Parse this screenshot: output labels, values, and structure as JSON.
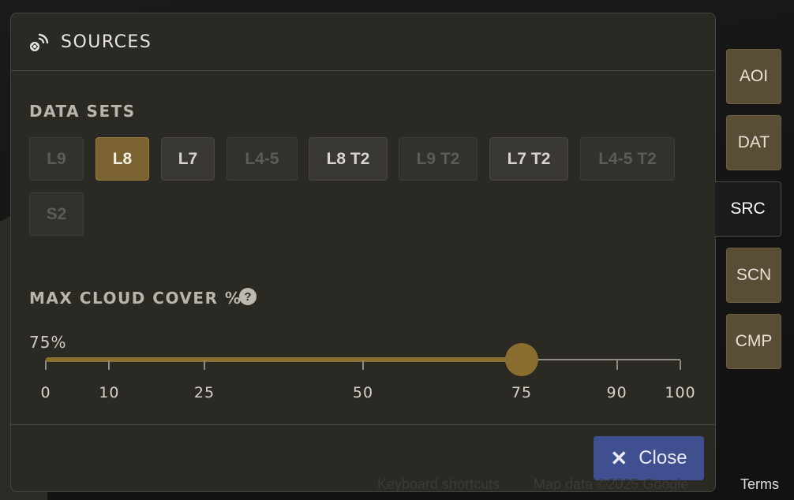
{
  "panel": {
    "title": "SOURCES",
    "icon": "satellite-icon"
  },
  "datasets": {
    "label": "DATA SETS",
    "items": [
      {
        "label": "L9",
        "state": "disabled"
      },
      {
        "label": "L8",
        "state": "selected"
      },
      {
        "label": "L7",
        "state": "enabled"
      },
      {
        "label": "L4-5",
        "state": "disabled"
      },
      {
        "label": "L8 T2",
        "state": "enabled"
      },
      {
        "label": "L9 T2",
        "state": "disabled"
      },
      {
        "label": "L7 T2",
        "state": "enabled"
      },
      {
        "label": "L4-5 T2",
        "state": "disabled"
      },
      {
        "label": "S2",
        "state": "disabled"
      }
    ]
  },
  "cloud_cover": {
    "label": "MAX CLOUD COVER %",
    "help_icon": "?",
    "value_text": "75%",
    "value": 75,
    "ticks": [
      "0",
      "10",
      "25",
      "50",
      "75",
      "90",
      "100"
    ]
  },
  "footer": {
    "close_label": "Close",
    "close_icon": "✕"
  },
  "side_tabs": [
    {
      "label": "AOI",
      "active": false
    },
    {
      "label": "DAT",
      "active": false
    },
    {
      "label": "SRC",
      "active": true
    },
    {
      "label": "SCN",
      "active": false
    },
    {
      "label": "CMP",
      "active": false
    }
  ],
  "map_footer": {
    "shortcuts": "Keyboard shortcuts",
    "map_data": "Map data ©2025 Google",
    "terms": "Terms"
  },
  "colors": {
    "accent": "#8a6e2f",
    "primary_button": "#3f4f8f",
    "panel_bg": "#2a2924"
  }
}
